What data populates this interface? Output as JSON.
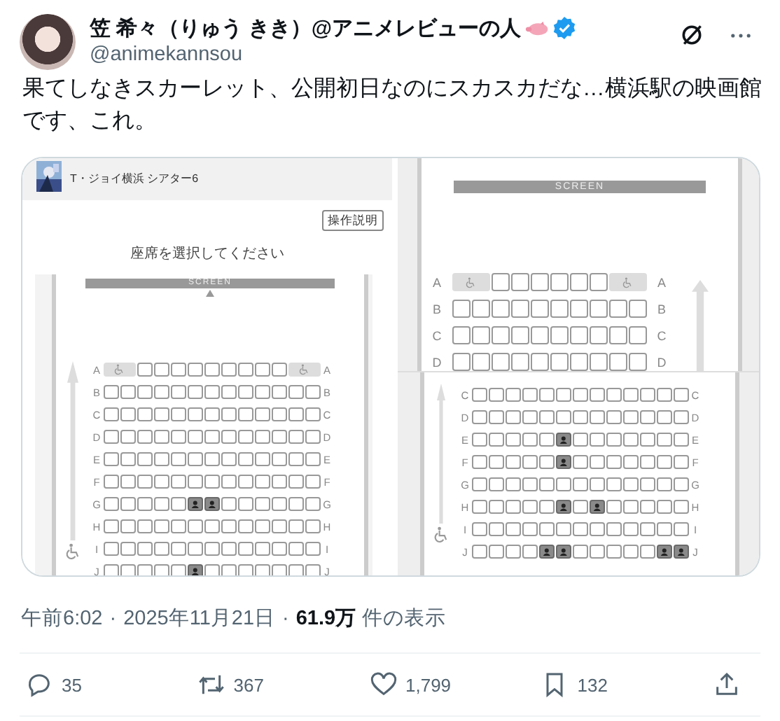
{
  "author": {
    "name": "笠 希々（りゅう きき）@アニメレビューの人",
    "handle": "@animekannsou"
  },
  "text": "果てしなきスカーレット、公開初日なのにスカスカだな…横浜駅の映画館です、これ。",
  "media": {
    "left": {
      "theater": "T・ジョイ横浜 シアター6",
      "help_button": "操作説明",
      "prompt": "座席を選択してください",
      "screen_label": "SCREEN",
      "rows": [
        {
          "label": "A",
          "label_right": "A",
          "seats": [
            {
              "kind": "wheelchair"
            },
            {
              "kind": "seat",
              "taken": false
            },
            {
              "kind": "seat",
              "taken": false
            },
            {
              "kind": "seat",
              "taken": false
            },
            {
              "kind": "seat",
              "taken": false
            },
            {
              "kind": "seat",
              "taken": false
            },
            {
              "kind": "seat",
              "taken": false
            },
            {
              "kind": "seat",
              "taken": false
            },
            {
              "kind": "seat",
              "taken": false
            },
            {
              "kind": "seat",
              "taken": false
            },
            {
              "kind": "wheelchair"
            }
          ]
        },
        {
          "label": "B",
          "label_right": "B",
          "seats": [
            {
              "kind": "seat",
              "taken": false
            },
            {
              "kind": "seat",
              "taken": false
            },
            {
              "kind": "seat",
              "taken": false
            },
            {
              "kind": "seat",
              "taken": false
            },
            {
              "kind": "seat",
              "taken": false
            },
            {
              "kind": "seat",
              "taken": false
            },
            {
              "kind": "seat",
              "taken": false
            },
            {
              "kind": "seat",
              "taken": false
            },
            {
              "kind": "seat",
              "taken": false
            },
            {
              "kind": "seat",
              "taken": false
            },
            {
              "kind": "seat",
              "taken": false
            },
            {
              "kind": "seat",
              "taken": false
            },
            {
              "kind": "seat",
              "taken": false
            }
          ]
        },
        {
          "label": "C",
          "label_right": "C",
          "seats": [
            {
              "kind": "seat",
              "taken": false
            },
            {
              "kind": "seat",
              "taken": false
            },
            {
              "kind": "seat",
              "taken": false
            },
            {
              "kind": "seat",
              "taken": false
            },
            {
              "kind": "seat",
              "taken": false
            },
            {
              "kind": "seat",
              "taken": false
            },
            {
              "kind": "seat",
              "taken": false
            },
            {
              "kind": "seat",
              "taken": false
            },
            {
              "kind": "seat",
              "taken": false
            },
            {
              "kind": "seat",
              "taken": false
            },
            {
              "kind": "seat",
              "taken": false
            },
            {
              "kind": "seat",
              "taken": false
            },
            {
              "kind": "seat",
              "taken": false
            }
          ]
        },
        {
          "label": "D",
          "label_right": "D",
          "seats": [
            {
              "kind": "seat",
              "taken": false
            },
            {
              "kind": "seat",
              "taken": false
            },
            {
              "kind": "seat",
              "taken": false
            },
            {
              "kind": "seat",
              "taken": false
            },
            {
              "kind": "seat",
              "taken": false
            },
            {
              "kind": "seat",
              "taken": false
            },
            {
              "kind": "seat",
              "taken": false
            },
            {
              "kind": "seat",
              "taken": false
            },
            {
              "kind": "seat",
              "taken": false
            },
            {
              "kind": "seat",
              "taken": false
            },
            {
              "kind": "seat",
              "taken": false
            },
            {
              "kind": "seat",
              "taken": false
            },
            {
              "kind": "seat",
              "taken": false
            }
          ]
        },
        {
          "label": "E",
          "label_right": "E",
          "seats": [
            {
              "kind": "seat",
              "taken": false
            },
            {
              "kind": "seat",
              "taken": false
            },
            {
              "kind": "seat",
              "taken": false
            },
            {
              "kind": "seat",
              "taken": false
            },
            {
              "kind": "seat",
              "taken": false
            },
            {
              "kind": "seat",
              "taken": false
            },
            {
              "kind": "seat",
              "taken": false
            },
            {
              "kind": "seat",
              "taken": false
            },
            {
              "kind": "seat",
              "taken": false
            },
            {
              "kind": "seat",
              "taken": false
            },
            {
              "kind": "seat",
              "taken": false
            },
            {
              "kind": "seat",
              "taken": false
            },
            {
              "kind": "seat",
              "taken": false
            }
          ]
        },
        {
          "label": "F",
          "label_right": "F",
          "seats": [
            {
              "kind": "seat",
              "taken": false
            },
            {
              "kind": "seat",
              "taken": false
            },
            {
              "kind": "seat",
              "taken": false
            },
            {
              "kind": "seat",
              "taken": false
            },
            {
              "kind": "seat",
              "taken": false
            },
            {
              "kind": "seat",
              "taken": false
            },
            {
              "kind": "seat",
              "taken": false
            },
            {
              "kind": "seat",
              "taken": false
            },
            {
              "kind": "seat",
              "taken": false
            },
            {
              "kind": "seat",
              "taken": false
            },
            {
              "kind": "seat",
              "taken": false
            },
            {
              "kind": "seat",
              "taken": false
            },
            {
              "kind": "seat",
              "taken": false
            }
          ]
        },
        {
          "label": "G",
          "label_right": "G",
          "seats": [
            {
              "kind": "seat",
              "taken": false
            },
            {
              "kind": "seat",
              "taken": false
            },
            {
              "kind": "seat",
              "taken": false
            },
            {
              "kind": "seat",
              "taken": false
            },
            {
              "kind": "seat",
              "taken": false
            },
            {
              "kind": "seat",
              "taken": true
            },
            {
              "kind": "seat",
              "taken": true
            },
            {
              "kind": "seat",
              "taken": false
            },
            {
              "kind": "seat",
              "taken": false
            },
            {
              "kind": "seat",
              "taken": false
            },
            {
              "kind": "seat",
              "taken": false
            },
            {
              "kind": "seat",
              "taken": false
            },
            {
              "kind": "seat",
              "taken": false
            }
          ]
        },
        {
          "label": "H",
          "label_right": "H",
          "seats": [
            {
              "kind": "seat",
              "taken": false
            },
            {
              "kind": "seat",
              "taken": false
            },
            {
              "kind": "seat",
              "taken": false
            },
            {
              "kind": "seat",
              "taken": false
            },
            {
              "kind": "seat",
              "taken": false
            },
            {
              "kind": "seat",
              "taken": false
            },
            {
              "kind": "seat",
              "taken": false
            },
            {
              "kind": "seat",
              "taken": false
            },
            {
              "kind": "seat",
              "taken": false
            },
            {
              "kind": "seat",
              "taken": false
            },
            {
              "kind": "seat",
              "taken": false
            },
            {
              "kind": "seat",
              "taken": false
            },
            {
              "kind": "seat",
              "taken": false
            }
          ]
        },
        {
          "label": "I",
          "label_right": "I",
          "seats": [
            {
              "kind": "seat",
              "taken": false
            },
            {
              "kind": "seat",
              "taken": false
            },
            {
              "kind": "seat",
              "taken": false
            },
            {
              "kind": "seat",
              "taken": false
            },
            {
              "kind": "seat",
              "taken": false
            },
            {
              "kind": "seat",
              "taken": false
            },
            {
              "kind": "seat",
              "taken": false
            },
            {
              "kind": "seat",
              "taken": false
            },
            {
              "kind": "seat",
              "taken": false
            },
            {
              "kind": "seat",
              "taken": false
            },
            {
              "kind": "seat",
              "taken": false
            },
            {
              "kind": "seat",
              "taken": false
            },
            {
              "kind": "seat",
              "taken": false
            }
          ]
        },
        {
          "label": "J",
          "label_right": "J",
          "seats": [
            {
              "kind": "seat",
              "taken": false
            },
            {
              "kind": "seat",
              "taken": false
            },
            {
              "kind": "seat",
              "taken": false
            },
            {
              "kind": "seat",
              "taken": false
            },
            {
              "kind": "seat",
              "taken": false
            },
            {
              "kind": "seat",
              "taken": true
            },
            {
              "kind": "seat",
              "taken": false
            },
            {
              "kind": "seat",
              "taken": false
            },
            {
              "kind": "seat",
              "taken": false
            },
            {
              "kind": "seat",
              "taken": false
            },
            {
              "kind": "seat",
              "taken": false
            },
            {
              "kind": "seat",
              "taken": false
            },
            {
              "kind": "seat",
              "taken": false
            }
          ]
        }
      ]
    },
    "right_top": {
      "screen_label": "SCREEN",
      "rows": [
        {
          "label": "A",
          "label_right": "A",
          "seats": [
            {
              "kind": "wheelchair"
            },
            {
              "kind": "seat",
              "taken": false
            },
            {
              "kind": "seat",
              "taken": false
            },
            {
              "kind": "seat",
              "taken": false
            },
            {
              "kind": "seat",
              "taken": false
            },
            {
              "kind": "seat",
              "taken": false
            },
            {
              "kind": "seat",
              "taken": false
            },
            {
              "kind": "wheelchair"
            }
          ]
        },
        {
          "label": "B",
          "label_right": "B",
          "seats": [
            {
              "kind": "seat",
              "taken": false
            },
            {
              "kind": "seat",
              "taken": false
            },
            {
              "kind": "seat",
              "taken": false
            },
            {
              "kind": "seat",
              "taken": false
            },
            {
              "kind": "seat",
              "taken": false
            },
            {
              "kind": "seat",
              "taken": false
            },
            {
              "kind": "seat",
              "taken": false
            },
            {
              "kind": "seat",
              "taken": false
            },
            {
              "kind": "seat",
              "taken": false
            },
            {
              "kind": "seat",
              "taken": false
            }
          ]
        },
        {
          "label": "C",
          "label_right": "C",
          "seats": [
            {
              "kind": "seat",
              "taken": false
            },
            {
              "kind": "seat",
              "taken": false
            },
            {
              "kind": "seat",
              "taken": false
            },
            {
              "kind": "seat",
              "taken": false
            },
            {
              "kind": "seat",
              "taken": false
            },
            {
              "kind": "seat",
              "taken": false
            },
            {
              "kind": "seat",
              "taken": false
            },
            {
              "kind": "seat",
              "taken": false
            },
            {
              "kind": "seat",
              "taken": false
            },
            {
              "kind": "seat",
              "taken": false
            }
          ]
        },
        {
          "label": "D",
          "label_right": "D",
          "seats": [
            {
              "kind": "seat",
              "taken": false
            },
            {
              "kind": "seat",
              "taken": false
            },
            {
              "kind": "seat",
              "taken": false
            },
            {
              "kind": "seat",
              "taken": false
            },
            {
              "kind": "seat",
              "taken": false
            },
            {
              "kind": "seat",
              "taken": false
            },
            {
              "kind": "seat",
              "taken": false
            },
            {
              "kind": "seat",
              "taken": false
            },
            {
              "kind": "seat",
              "taken": false
            },
            {
              "kind": "seat",
              "taken": false
            }
          ]
        }
      ]
    },
    "right_bottom": {
      "rows": [
        {
          "label": "C",
          "label_right": "C",
          "seats": [
            {
              "kind": "seat",
              "taken": false
            },
            {
              "kind": "seat",
              "taken": false
            },
            {
              "kind": "seat",
              "taken": false
            },
            {
              "kind": "seat",
              "taken": false
            },
            {
              "kind": "seat",
              "taken": false
            },
            {
              "kind": "seat",
              "taken": false
            },
            {
              "kind": "seat",
              "taken": false
            },
            {
              "kind": "seat",
              "taken": false
            },
            {
              "kind": "seat",
              "taken": false
            },
            {
              "kind": "seat",
              "taken": false
            },
            {
              "kind": "seat",
              "taken": false
            },
            {
              "kind": "seat",
              "taken": false
            },
            {
              "kind": "seat",
              "taken": false
            }
          ]
        },
        {
          "label": "D",
          "label_right": "D",
          "seats": [
            {
              "kind": "seat",
              "taken": false
            },
            {
              "kind": "seat",
              "taken": false
            },
            {
              "kind": "seat",
              "taken": false
            },
            {
              "kind": "seat",
              "taken": false
            },
            {
              "kind": "seat",
              "taken": false
            },
            {
              "kind": "seat",
              "taken": false
            },
            {
              "kind": "seat",
              "taken": false
            },
            {
              "kind": "seat",
              "taken": false
            },
            {
              "kind": "seat",
              "taken": false
            },
            {
              "kind": "seat",
              "taken": false
            },
            {
              "kind": "seat",
              "taken": false
            },
            {
              "kind": "seat",
              "taken": false
            },
            {
              "kind": "seat",
              "taken": false
            }
          ]
        },
        {
          "label": "E",
          "label_right": "E",
          "seats": [
            {
              "kind": "seat",
              "taken": false
            },
            {
              "kind": "seat",
              "taken": false
            },
            {
              "kind": "seat",
              "taken": false
            },
            {
              "kind": "seat",
              "taken": false
            },
            {
              "kind": "seat",
              "taken": false
            },
            {
              "kind": "seat",
              "taken": true
            },
            {
              "kind": "seat",
              "taken": false
            },
            {
              "kind": "seat",
              "taken": false
            },
            {
              "kind": "seat",
              "taken": false
            },
            {
              "kind": "seat",
              "taken": false
            },
            {
              "kind": "seat",
              "taken": false
            },
            {
              "kind": "seat",
              "taken": false
            },
            {
              "kind": "seat",
              "taken": false
            }
          ]
        },
        {
          "label": "F",
          "label_right": "F",
          "seats": [
            {
              "kind": "seat",
              "taken": false
            },
            {
              "kind": "seat",
              "taken": false
            },
            {
              "kind": "seat",
              "taken": false
            },
            {
              "kind": "seat",
              "taken": false
            },
            {
              "kind": "seat",
              "taken": false
            },
            {
              "kind": "seat",
              "taken": true
            },
            {
              "kind": "seat",
              "taken": false
            },
            {
              "kind": "seat",
              "taken": false
            },
            {
              "kind": "seat",
              "taken": false
            },
            {
              "kind": "seat",
              "taken": false
            },
            {
              "kind": "seat",
              "taken": false
            },
            {
              "kind": "seat",
              "taken": false
            },
            {
              "kind": "seat",
              "taken": false
            }
          ]
        },
        {
          "label": "G",
          "label_right": "G",
          "seats": [
            {
              "kind": "seat",
              "taken": false
            },
            {
              "kind": "seat",
              "taken": false
            },
            {
              "kind": "seat",
              "taken": false
            },
            {
              "kind": "seat",
              "taken": false
            },
            {
              "kind": "seat",
              "taken": false
            },
            {
              "kind": "seat",
              "taken": false
            },
            {
              "kind": "seat",
              "taken": false
            },
            {
              "kind": "seat",
              "taken": false
            },
            {
              "kind": "seat",
              "taken": false
            },
            {
              "kind": "seat",
              "taken": false
            },
            {
              "kind": "seat",
              "taken": false
            },
            {
              "kind": "seat",
              "taken": false
            },
            {
              "kind": "seat",
              "taken": false
            }
          ]
        },
        {
          "label": "H",
          "label_right": "H",
          "seats": [
            {
              "kind": "seat",
              "taken": false
            },
            {
              "kind": "seat",
              "taken": false
            },
            {
              "kind": "seat",
              "taken": false
            },
            {
              "kind": "seat",
              "taken": false
            },
            {
              "kind": "seat",
              "taken": false
            },
            {
              "kind": "seat",
              "taken": true
            },
            {
              "kind": "seat",
              "taken": false
            },
            {
              "kind": "seat",
              "taken": true
            },
            {
              "kind": "seat",
              "taken": false
            },
            {
              "kind": "seat",
              "taken": false
            },
            {
              "kind": "seat",
              "taken": false
            },
            {
              "kind": "seat",
              "taken": false
            },
            {
              "kind": "seat",
              "taken": false
            }
          ]
        },
        {
          "label": "I",
          "label_right": "I",
          "seats": [
            {
              "kind": "seat",
              "taken": false
            },
            {
              "kind": "seat",
              "taken": false
            },
            {
              "kind": "seat",
              "taken": false
            },
            {
              "kind": "seat",
              "taken": false
            },
            {
              "kind": "seat",
              "taken": false
            },
            {
              "kind": "seat",
              "taken": false
            },
            {
              "kind": "seat",
              "taken": false
            },
            {
              "kind": "seat",
              "taken": false
            },
            {
              "kind": "seat",
              "taken": false
            },
            {
              "kind": "seat",
              "taken": false
            },
            {
              "kind": "seat",
              "taken": false
            },
            {
              "kind": "seat",
              "taken": false
            },
            {
              "kind": "seat",
              "taken": false
            }
          ]
        },
        {
          "label": "J",
          "label_right": "J",
          "seats": [
            {
              "kind": "seat",
              "taken": false
            },
            {
              "kind": "seat",
              "taken": false
            },
            {
              "kind": "seat",
              "taken": false
            },
            {
              "kind": "seat",
              "taken": false
            },
            {
              "kind": "seat",
              "taken": true
            },
            {
              "kind": "seat",
              "taken": true
            },
            {
              "kind": "seat",
              "taken": false
            },
            {
              "kind": "seat",
              "taken": false
            },
            {
              "kind": "seat",
              "taken": false
            },
            {
              "kind": "seat",
              "taken": false
            },
            {
              "kind": "seat",
              "taken": false
            },
            {
              "kind": "seat",
              "taken": true
            },
            {
              "kind": "seat",
              "taken": true
            }
          ]
        }
      ]
    }
  },
  "meta": {
    "time": "午前6:02",
    "separator_1": "·",
    "date": "2025年11月21日",
    "separator_2": "·",
    "views": "61.9万",
    "views_label": "件の表示"
  },
  "actions": [
    {
      "kind": "reply",
      "count": "35"
    },
    {
      "kind": "repost",
      "count": "367"
    },
    {
      "kind": "like",
      "count": "1,799"
    },
    {
      "kind": "bookmark",
      "count": "132"
    },
    {
      "kind": "share"
    }
  ]
}
